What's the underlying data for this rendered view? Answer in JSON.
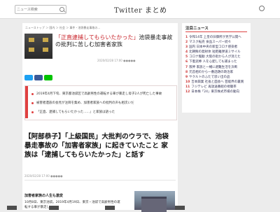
{
  "header": {
    "search_placeholder": "ニュース検索",
    "logo": "Twitter まとめ"
  },
  "article": {
    "breadcrumb": "ニューストップ ＞ 国内 ＞ 社会 ＞ 事件・池袋暴走事故の…",
    "title_highlight": "「正直逮捕してもらいたかった」",
    "title_rest": "池袋暴走事故の批判に苦しむ加害者家族",
    "date": "2020/02/28 17:00 ●●●●●",
    "summary": [
      "2019年4月下旬、東京都池袋区で高齢男性の運転する車が暴走し母子2人が死亡した事故",
      "被害者遺族の会見が注目を集め、加害者家族への批判の声も相次いだ",
      "「正直、逮捕してもらいたかった……」と家族は語った"
    ],
    "big_headline": "【阿部恭子】「上級国民」大批判のウラで、池袋暴走事故の「加害者家族」に起きていたこと 家族は「逮捕してもらいたかった」と話す",
    "date2": "2020/02/28 17:00 ●●●●●",
    "subheading": "加害者家族の人生も激変",
    "body": "10月8日、東京池袋。2019年4月19日、東京・池袋で高齢男性の運転する車が暴走し……"
  },
  "sidebar": {
    "title": "注目ニュース",
    "items": [
      {
        "rank": "1",
        "text": "令和14年 上皇の旧御所が見学公開へ"
      },
      {
        "rank": "2",
        "text": "マスク転売 食品スーパー続々"
      },
      {
        "rank": "3",
        "text": "国内 日本中央の新型コロナ感染者"
      },
      {
        "rank": "4",
        "text": "北朝鮮の発射体 短距離弾道ミサイル"
      },
      {
        "rank": "5",
        "text": "コロナ騒動 大阪の街から人が消えた"
      },
      {
        "rank": "6",
        "text": "下着泥棒 人を心配しても捕まった"
      },
      {
        "rank": "7",
        "text": "阪神 家族と一緒に避難生活を決断"
      },
      {
        "rank": "8",
        "text": "元首相のから一番話題の政治家"
      },
      {
        "rank": "9",
        "text": "ヤクルトのふたで思い出の品"
      },
      {
        "rank": "10",
        "text": "吉本興業 社長と面会へ 芸能界の裏側"
      },
      {
        "rank": "11",
        "text": "フジテレビ 再放送番組の視聴率"
      },
      {
        "rank": "12",
        "text": "日本株「24」東京株式市場の動向"
      }
    ]
  }
}
